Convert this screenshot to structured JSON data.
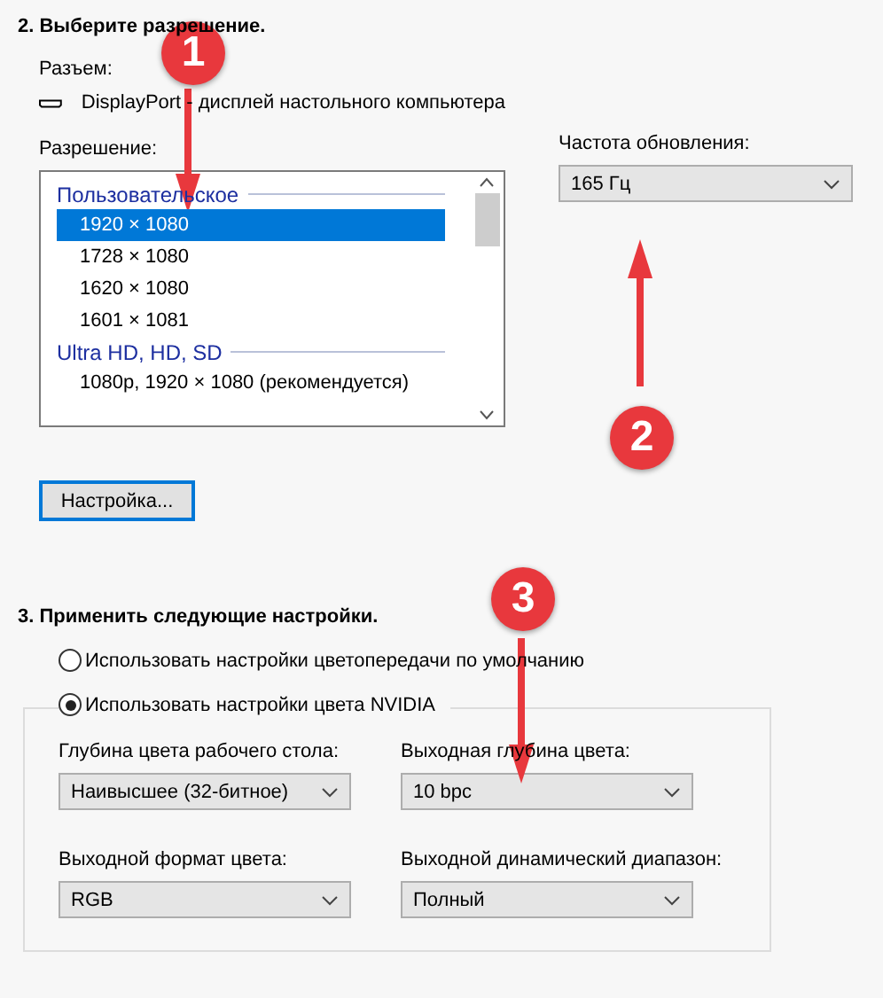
{
  "resolution_section": {
    "heading": "2. Выберите разрешение.",
    "connector_label": "Разъем:",
    "connector": "DisplayPort - дисплей настольного компьютера",
    "resolution_label": "Разрешение:",
    "resolution_groups": [
      {
        "title": "Пользовательское",
        "items": [
          {
            "label": "1920 × 1080",
            "selected": true
          },
          {
            "label": "1728 × 1080",
            "selected": false
          },
          {
            "label": "1620 × 1080",
            "selected": false
          },
          {
            "label": "1601 × 1081",
            "selected": false
          }
        ]
      },
      {
        "title": "Ultra HD, HD, SD",
        "items": [
          {
            "label": "1080p, 1920 × 1080 (рекомендуется)",
            "selected": false
          }
        ]
      }
    ],
    "refresh_label": "Частота обновления:",
    "refresh_value": "165 Гц",
    "customize_button": "Настройка..."
  },
  "apply_section": {
    "heading": "3. Применить следующие настройки.",
    "options": [
      {
        "label": "Использовать настройки цветопередачи по умолчанию",
        "selected": false
      },
      {
        "label": "Использовать настройки цвета NVIDIA",
        "selected": true
      }
    ],
    "fields": [
      {
        "label": "Глубина цвета рабочего стола:",
        "value": "Наивысшее (32-битное)"
      },
      {
        "label": "Выходная глубина цвета:",
        "value": "10 bpc"
      },
      {
        "label": "Выходной формат цвета:",
        "value": "RGB"
      },
      {
        "label": "Выходной динамический диапазон:",
        "value": "Полный"
      }
    ]
  },
  "annotations": [
    {
      "number": "1",
      "kind": "down"
    },
    {
      "number": "2",
      "kind": "up"
    },
    {
      "number": "3",
      "kind": "down"
    }
  ]
}
